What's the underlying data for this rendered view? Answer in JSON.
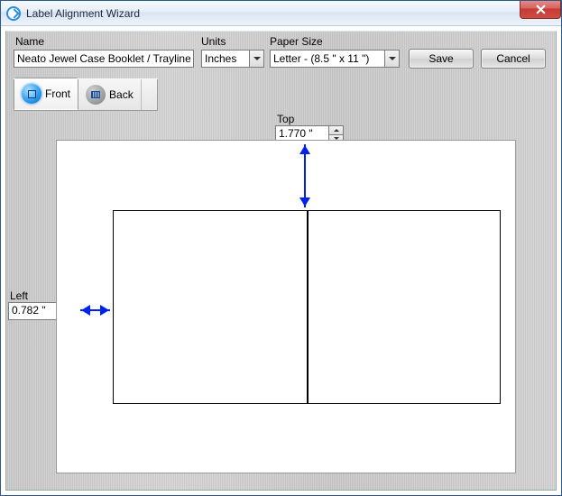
{
  "window": {
    "title": "Label Alignment Wizard"
  },
  "fields": {
    "name_label": "Name",
    "name_value": "Neato Jewel Case Booklet / Trayliner",
    "units_label": "Units",
    "units_value": "Inches",
    "paper_label": "Paper Size",
    "paper_value": "Letter - (8.5 \" x 11 \")"
  },
  "buttons": {
    "save": "Save",
    "cancel": "Cancel"
  },
  "tabs": {
    "front": "Front",
    "back": "Back",
    "active": "front"
  },
  "offsets": {
    "top_label": "Top",
    "top_value": "1.770 \"",
    "left_label": "Left",
    "left_value": "0.782 \""
  }
}
